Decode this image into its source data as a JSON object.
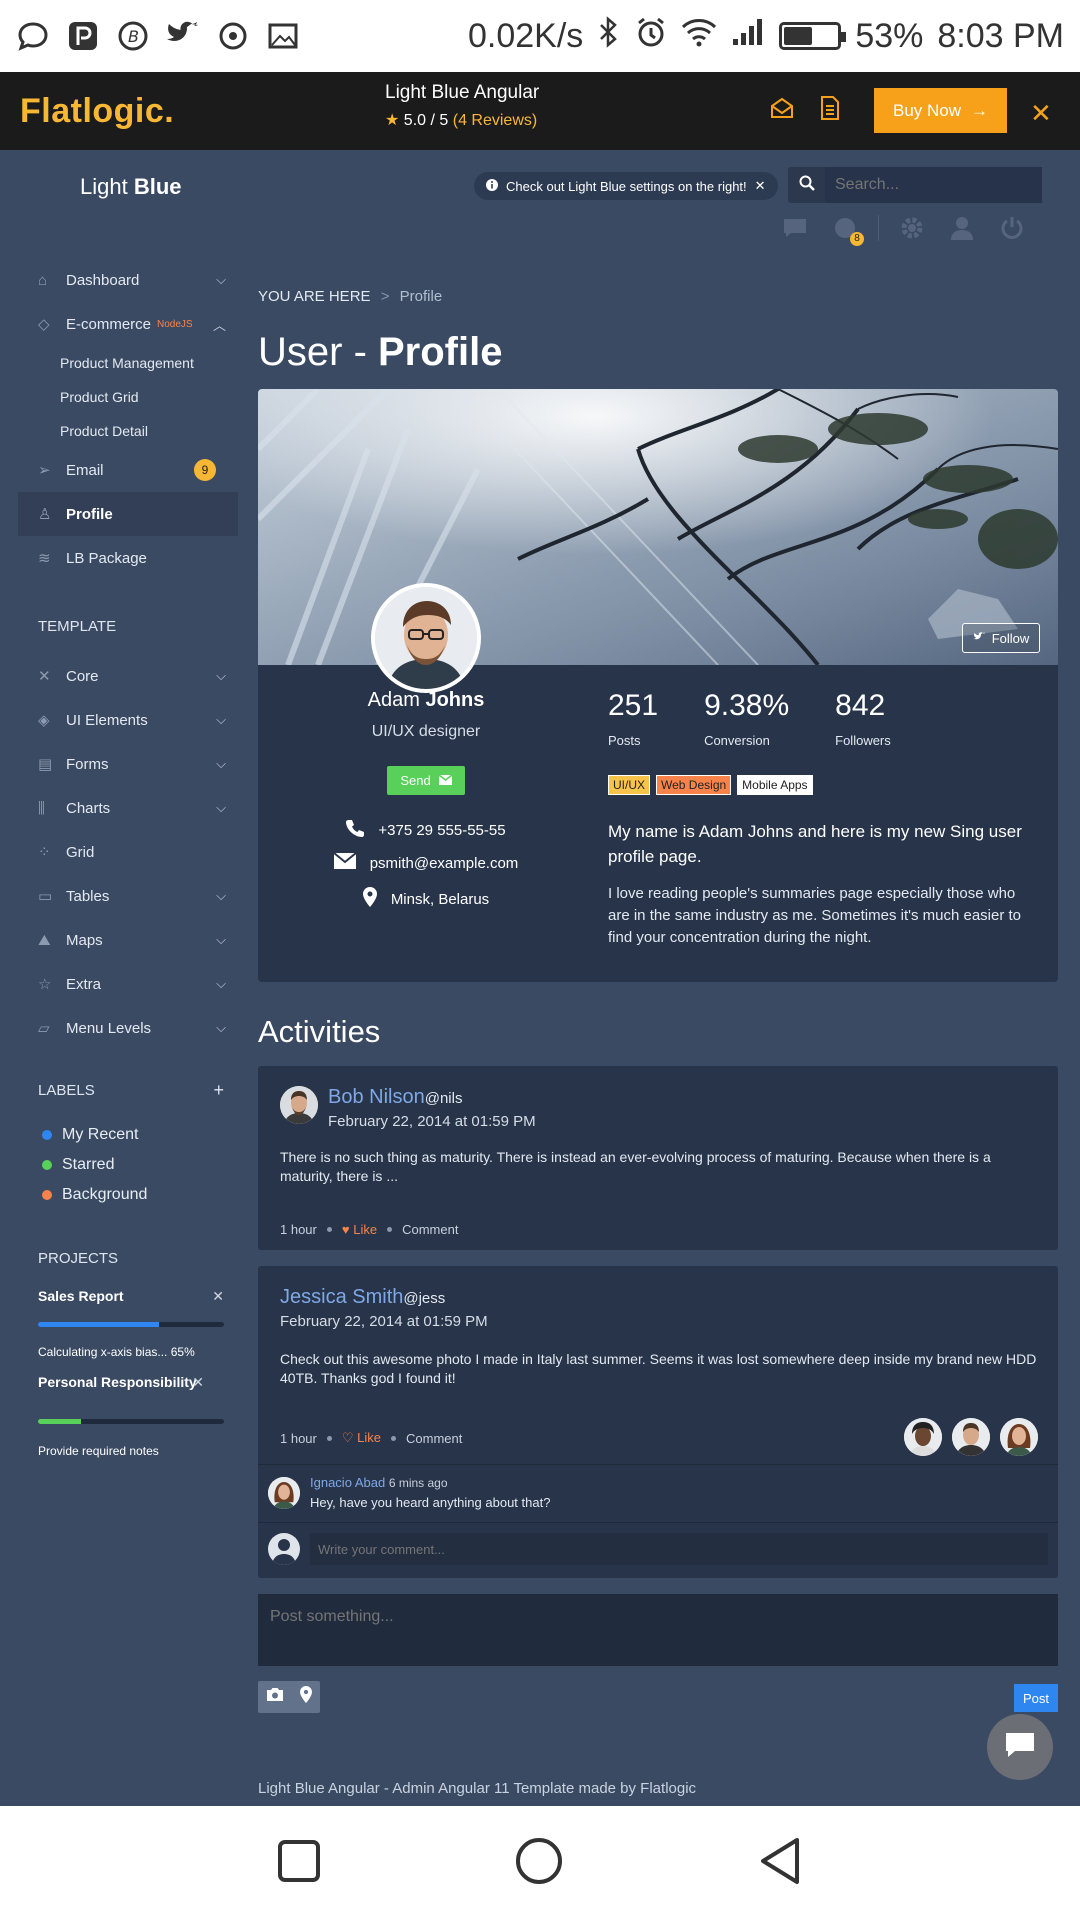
{
  "status_bar": {
    "net_speed": "0.02K/s",
    "battery": "53%",
    "battery_level": 0.53,
    "time": "8:03 PM"
  },
  "promo": {
    "logo": "Flatlogic.",
    "product": "Light Blue Angular",
    "rating": "5.0 / 5",
    "reviews": "(4 Reviews)",
    "buy_label": "Buy Now",
    "close": "✕"
  },
  "header": {
    "brand_light": "Light",
    "brand_bold": "Blue",
    "notice": "Check out Light Blue settings on the right!",
    "notice_close": "✕",
    "search_placeholder": "Search...",
    "notif_badge": "8"
  },
  "sidebar": {
    "items": [
      {
        "label": "Dashboard",
        "icon": "home-icon"
      },
      {
        "label": "E-commerce",
        "icon": "diamond-icon",
        "sup": "NodeJS"
      },
      {
        "label": "Email",
        "icon": "paper-plane-icon",
        "badge": "9"
      },
      {
        "label": "Profile",
        "icon": "user-icon"
      },
      {
        "label": "LB Package",
        "icon": "database-icon"
      }
    ],
    "ecommerce_sub": [
      "Product Management",
      "Product Grid",
      "Product Detail"
    ],
    "template_heading": "TEMPLATE",
    "template_items": [
      {
        "label": "Core",
        "icon": "tools-icon"
      },
      {
        "label": "UI Elements",
        "icon": "layers-icon"
      },
      {
        "label": "Forms",
        "icon": "document-icon"
      },
      {
        "label": "Charts",
        "icon": "chart-icon"
      },
      {
        "label": "Grid",
        "icon": "grid-icon"
      },
      {
        "label": "Tables",
        "icon": "table-icon"
      },
      {
        "label": "Maps",
        "icon": "map-icon"
      },
      {
        "label": "Extra",
        "icon": "star-icon"
      },
      {
        "label": "Menu Levels",
        "icon": "folder-icon"
      }
    ],
    "labels_heading": "LABELS",
    "labels_add": "+",
    "labels": [
      {
        "label": "My Recent",
        "color": "#2e87f1"
      },
      {
        "label": "Starred",
        "color": "#58d05a"
      },
      {
        "label": "Background",
        "color": "#f7834a"
      }
    ],
    "projects_heading": "PROJECTS",
    "projects": [
      {
        "title": "Sales Report",
        "note": "Calculating x-axis bias... 65%",
        "progress": 0.65,
        "color": "#2e87f1"
      },
      {
        "title": "Personal Responsibility",
        "note": "Provide required notes",
        "progress": 0.23,
        "color": "#58d05a"
      }
    ]
  },
  "breadcrumb": {
    "prefix": "YOU ARE HERE",
    "sep": ">",
    "current": "Profile"
  },
  "page_title": {
    "light": "User - ",
    "bold": "Profile"
  },
  "profile": {
    "follow_label": "Follow",
    "first_name": "Adam",
    "last_name": "Johns",
    "role": "UI/UX designer",
    "send_label": "Send",
    "phone": "+375 29 555-55-55",
    "email": "psmith@example.com",
    "location": "Minsk, Belarus",
    "stats": [
      {
        "value": "251",
        "label": "Posts"
      },
      {
        "value": "9.38%",
        "label": "Conversion"
      },
      {
        "value": "842",
        "label": "Followers"
      }
    ],
    "tags": [
      {
        "label": "UI/UX",
        "bg": "#f7c34a",
        "fg": "#222"
      },
      {
        "label": "Web Design",
        "bg": "#f7834a",
        "fg": "#222"
      },
      {
        "label": "Mobile Apps",
        "bg": "#ffffff",
        "fg": "#222"
      }
    ],
    "bio_lead": "My name is Adam Johns and here is my new Sing user profile page.",
    "bio": "I love reading people's summaries page especially those who are in the same industry as me. Sometimes it's much easier to find your concentration during the night."
  },
  "activities": {
    "title": "Activities",
    "posts": [
      {
        "name": "Bob Nilson",
        "handle": "@nils",
        "date": "February 22, 2014 at 01:59 PM",
        "text": "There is no such thing as maturity. There is instead an ever-evolving process of maturing. Because when there is a maturity, there is ...",
        "time": "1 hour",
        "like": "Like",
        "comment": "Comment"
      },
      {
        "name": "Jessica Smith",
        "handle": "@jess",
        "date": "February 22, 2014 at 01:59 PM",
        "text": "Check out this awesome photo I made in Italy last summer. Seems it was lost somewhere deep inside my brand new HDD 40TB. Thanks god I found it!",
        "time": "1 hour",
        "like": "Like",
        "comment": "Comment",
        "reply": {
          "name": "Ignacio Abad",
          "time": "6 mins ago",
          "text": "Hey, have you heard anything about that?"
        },
        "comment_placeholder": "Write your comment..."
      }
    ]
  },
  "composer": {
    "placeholder": "Post something...",
    "post_label": "Post"
  },
  "footer": "Light Blue Angular - Admin Angular 11 Template made by Flatlogic"
}
